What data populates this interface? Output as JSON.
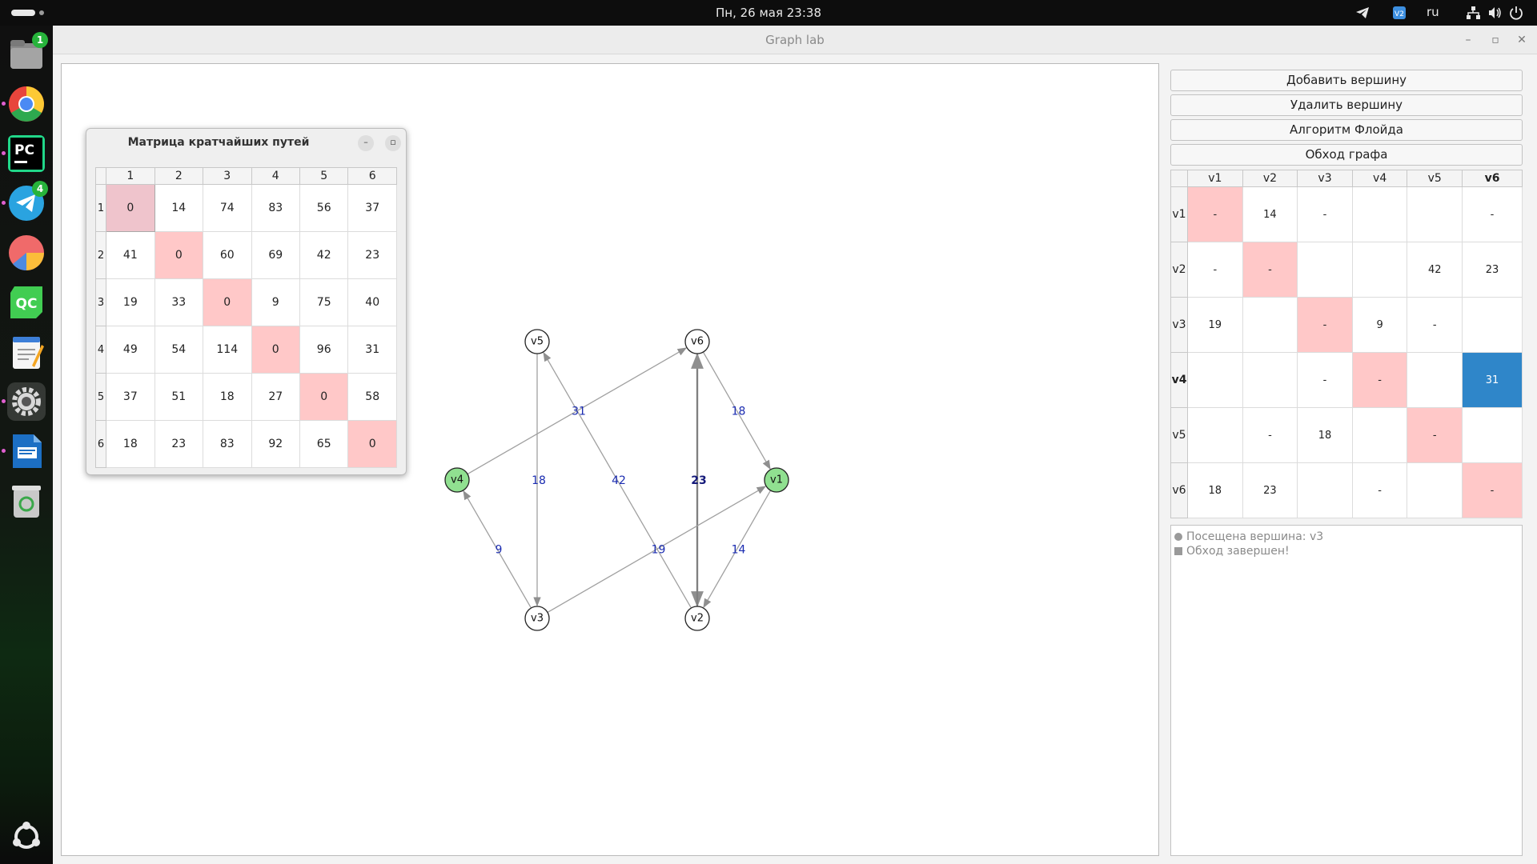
{
  "system": {
    "datetime": "Пн, 26 мая  23:38",
    "keyboard_layout": "ru",
    "tray_icons": [
      "telegram-tray-icon",
      "vpn-tray-icon",
      "network-icon",
      "volume-icon",
      "power-icon"
    ]
  },
  "dock": {
    "items": [
      {
        "name": "files",
        "badge": "1"
      },
      {
        "name": "chrome",
        "badge": ""
      },
      {
        "name": "pycharm",
        "label": "PC",
        "badge": ""
      },
      {
        "name": "telegram",
        "badge": "4"
      },
      {
        "name": "pie-app",
        "badge": ""
      },
      {
        "name": "qt-creator",
        "label": "QC",
        "badge": ""
      },
      {
        "name": "text-editor",
        "badge": ""
      },
      {
        "name": "settings",
        "badge": ""
      },
      {
        "name": "writer",
        "badge": ""
      },
      {
        "name": "trash",
        "badge": ""
      }
    ]
  },
  "window": {
    "title": "Graph lab"
  },
  "floyd_dialog": {
    "title": "Матрица кратчайших путей",
    "columns": [
      "1",
      "2",
      "3",
      "4",
      "5",
      "6"
    ],
    "rows": [
      {
        "label": "1",
        "cells": [
          "0",
          "14",
          "74",
          "83",
          "56",
          "37"
        ]
      },
      {
        "label": "2",
        "cells": [
          "41",
          "0",
          "60",
          "69",
          "42",
          "23"
        ]
      },
      {
        "label": "3",
        "cells": [
          "19",
          "33",
          "0",
          "9",
          "75",
          "40"
        ]
      },
      {
        "label": "4",
        "cells": [
          "49",
          "54",
          "114",
          "0",
          "96",
          "31"
        ]
      },
      {
        "label": "5",
        "cells": [
          "37",
          "51",
          "18",
          "27",
          "0",
          "58"
        ]
      },
      {
        "label": "6",
        "cells": [
          "18",
          "23",
          "83",
          "92",
          "65",
          "0"
        ]
      }
    ]
  },
  "buttons": {
    "add_vertex": "Добавить вершину",
    "remove_vertex": "Удалить вершину",
    "floyd": "Алгоритм Флойда",
    "traversal": "Обход графа"
  },
  "adjacency": {
    "columns": [
      "v1",
      "v2",
      "v3",
      "v4",
      "v5",
      "v6"
    ],
    "rows": [
      {
        "label": "v1",
        "cells": [
          "-",
          "14",
          "-",
          "",
          "",
          "-"
        ]
      },
      {
        "label": "v2",
        "cells": [
          "-",
          "-",
          "",
          "",
          "42",
          "23"
        ]
      },
      {
        "label": "v3",
        "cells": [
          "19",
          "",
          "-",
          "9",
          "-",
          ""
        ]
      },
      {
        "label": "v4",
        "cells": [
          "",
          "",
          "-",
          "-",
          "",
          "31"
        ]
      },
      {
        "label": "v5",
        "cells": [
          "",
          "-",
          "18",
          "",
          "-",
          ""
        ]
      },
      {
        "label": "v6",
        "cells": [
          "18",
          "23",
          "",
          "-",
          "",
          "-"
        ]
      }
    ],
    "current_row": "v4",
    "current_column": "v6",
    "selected_value": "31"
  },
  "log": {
    "lines": [
      {
        "marker": "circle",
        "text": "Посещена вершина: v3"
      },
      {
        "marker": "square",
        "text": "Обход завершен!"
      }
    ]
  },
  "graph": {
    "node_fill_default": "#ffffff",
    "node_fill_visited": "#90e090",
    "nodes": [
      {
        "id": "v1",
        "visited": true
      },
      {
        "id": "v2",
        "visited": false
      },
      {
        "id": "v3",
        "visited": false
      },
      {
        "id": "v4",
        "visited": true
      },
      {
        "id": "v5",
        "visited": false
      },
      {
        "id": "v6",
        "visited": false
      }
    ],
    "edges": [
      {
        "from": "v4",
        "to": "v6",
        "weight": "31"
      },
      {
        "from": "v5",
        "to": "v3",
        "weight": "18"
      },
      {
        "from": "v2",
        "to": "v5",
        "weight": "42"
      },
      {
        "from": "v6",
        "to": "v2",
        "weight": "23"
      },
      {
        "from": "v2",
        "to": "v6",
        "weight": "23"
      },
      {
        "from": "v6",
        "to": "v1",
        "weight": "18"
      },
      {
        "from": "v3",
        "to": "v4",
        "weight": "9"
      },
      {
        "from": "v3",
        "to": "v1",
        "weight": "19"
      },
      {
        "from": "v1",
        "to": "v2",
        "weight": "14"
      }
    ]
  }
}
